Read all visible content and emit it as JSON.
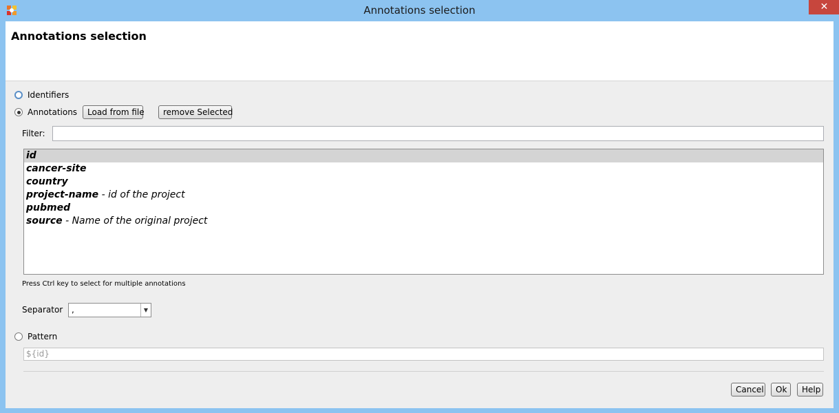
{
  "window": {
    "title": "Annotations selection",
    "close_label": "✕"
  },
  "header": {
    "title": "Annotations selection"
  },
  "options": {
    "identifiers_label": "Identifiers",
    "annotations_label": "Annotations",
    "pattern_label": "Pattern",
    "selected": "annotations"
  },
  "buttons": {
    "load_from_file": "Load from file",
    "remove_selected": "remove Selected",
    "cancel": "Cancel",
    "ok": "Ok",
    "help": "Help"
  },
  "filter": {
    "label": "Filter:",
    "value": ""
  },
  "annotations_list": [
    {
      "key": "id",
      "desc": "",
      "selected": true
    },
    {
      "key": "cancer-site",
      "desc": "",
      "selected": false
    },
    {
      "key": "country",
      "desc": "",
      "selected": false
    },
    {
      "key": "project-name",
      "desc": " - id of the project",
      "selected": false
    },
    {
      "key": "pubmed",
      "desc": "",
      "selected": false
    },
    {
      "key": "source",
      "desc": " - Name of the original project",
      "selected": false
    }
  ],
  "hint": "Press Ctrl key to select for multiple annotations",
  "separator": {
    "label": "Separator",
    "value": ","
  },
  "pattern": {
    "value": "${id}"
  },
  "colors": {
    "titlebar": "#8cc3f0",
    "close_button": "#c7463d"
  }
}
